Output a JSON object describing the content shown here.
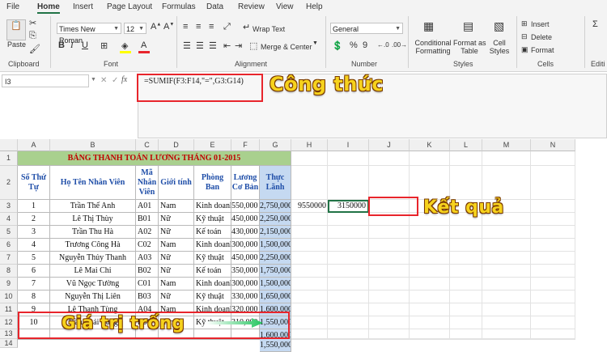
{
  "menu": [
    "File",
    "Home",
    "Insert",
    "Page Layout",
    "Formulas",
    "Data",
    "Review",
    "View",
    "Help"
  ],
  "ribbon": {
    "paste_label": "Paste",
    "clipboard_label": "Clipboard",
    "font_name": "Times New Roman",
    "font_size": "12",
    "font_label": "Font",
    "wrap_text": "Wrap Text",
    "merge_center": "Merge & Center",
    "alignment_label": "Alignment",
    "number_format": "General",
    "number_label": "Number",
    "percent_symbol": "%",
    "comma_symbol": "9",
    "conditional_formatting": [
      "Conditional",
      "Formatting"
    ],
    "format_as_table": [
      "Format as",
      "Table"
    ],
    "cell_styles": [
      "Cell",
      "Styles"
    ],
    "styles_label": "Styles",
    "insert": "Insert",
    "delete": "Delete",
    "format": "Format",
    "cells_label": "Cells",
    "editing_label": "Editi",
    "bold": "B",
    "italic": "I",
    "underline": "U",
    "font_color_letter": "A"
  },
  "formula_bar": {
    "name_box": "I3",
    "fx": "fx",
    "formula": "=SUMIF(F3:F14,\"=\",G3:G14)"
  },
  "callouts": {
    "formula": "Công thức",
    "result": "Kết quả",
    "empty": "Giá trị trống"
  },
  "columns": [
    "A",
    "B",
    "C",
    "D",
    "E",
    "F",
    "G",
    "H",
    "I",
    "J",
    "K",
    "L",
    "M",
    "N"
  ],
  "rows": [
    "1",
    "2",
    "3",
    "4",
    "5",
    "6",
    "7",
    "8",
    "9",
    "10",
    "11",
    "12",
    "13",
    "14"
  ],
  "sheet": {
    "title": "BẢNG THANH TOÁN LƯƠNG THÁNG 01-2015",
    "headers": [
      "Số Thứ Tự",
      "Họ Tên Nhân Viên",
      "Mã Nhân Viên",
      "Giới tính",
      "Phòng Ban",
      "Lương Cơ Bản",
      "Thực Lãnh"
    ],
    "data": [
      [
        "1",
        "Trần Thế Anh",
        "A01",
        "Nam",
        "Kinh doanh",
        "550,000",
        "2,750,000"
      ],
      [
        "2",
        "Lê Thị Thùy",
        "B01",
        "Nữ",
        "Kỹ thuật",
        "450,000",
        "2,250,000"
      ],
      [
        "3",
        "Trần Thu Hà",
        "A02",
        "Nữ",
        "Kế toán",
        "430,000",
        "2,150,000"
      ],
      [
        "4",
        "Trương Công Hà",
        "C02",
        "Nam",
        "Kinh doanh",
        "300,000",
        "1,500,000"
      ],
      [
        "5",
        "Nguyễn Thủy Thanh",
        "A03",
        "Nữ",
        "Kỹ thuật",
        "450,000",
        "2,250,000"
      ],
      [
        "6",
        "Lê Mai Chi",
        "B02",
        "Nữ",
        "Kế toán",
        "350,000",
        "1,750,000"
      ],
      [
        "7",
        "Vũ Ngọc Tường",
        "C01",
        "Nam",
        "Kinh doanh",
        "300,000",
        "1,500,000"
      ],
      [
        "8",
        "Nguyễn Thị Liên",
        "B03",
        "Nữ",
        "Kỹ thuật",
        "330,000",
        "1,650,000"
      ],
      [
        "9",
        "Lê Thanh Tùng",
        "A04",
        "Nam",
        "Kinh doanh",
        "320,000",
        "1,600,000"
      ],
      [
        "10",
        "Trần Thái Tùng",
        "B06",
        "Nam",
        "Kỹ thuật",
        "310,000",
        "1,550,000"
      ],
      [
        "",
        "",
        "",
        "",
        "",
        "",
        "1,600,000"
      ],
      [
        "",
        "",
        "",
        "",
        "",
        "",
        "1,550,000"
      ]
    ],
    "h3": "9550000",
    "i3": "3150000"
  },
  "colors": {
    "accent": "#217346",
    "title_bg": "#a9d08e",
    "title_text": "#c00000",
    "header_text": "#1f4ea8",
    "highlight_blue": "#c5d9f1",
    "callout_red": "#e8252c",
    "callout_yellow": "#f6d21d",
    "arrow_green": "#22c55e"
  }
}
